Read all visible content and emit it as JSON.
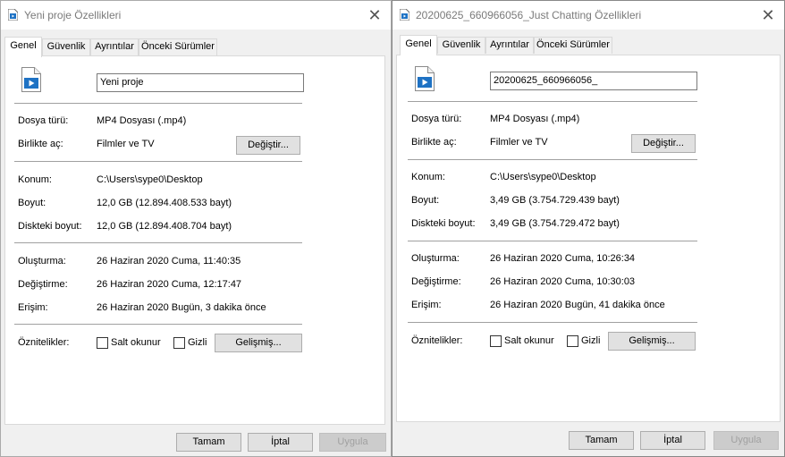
{
  "windows": [
    {
      "title": "Yeni proje Özellikleri",
      "tabs": [
        "Genel",
        "Güvenlik",
        "Ayrıntılar",
        "Önceki Sürümler"
      ],
      "name_value": "Yeni proje",
      "file_type_label": "Dosya türü:",
      "file_type_value": "MP4 Dosyası (.mp4)",
      "open_with_label": "Birlikte aç:",
      "open_with_value": "Filmler ve TV",
      "change_button": "Değiştir...",
      "location_label": "Konum:",
      "location_value": "C:\\Users\\sype0\\Desktop",
      "size_label": "Boyut:",
      "size_value": "12,0 GB (12.894.408.533 bayt)",
      "disk_size_label": "Diskteki boyut:",
      "disk_size_value": "12,0 GB (12.894.408.704 bayt)",
      "created_label": "Oluşturma:",
      "created_value": "26 Haziran 2020 Cuma, 11:40:35",
      "modified_label": "Değiştirme:",
      "modified_value": "26 Haziran 2020 Cuma, 12:17:47",
      "accessed_label": "Erişim:",
      "accessed_value": "26 Haziran 2020 Bugün, 3 dakika önce",
      "attributes_label": "Öznitelikler:",
      "readonly_label": "Salt okunur",
      "hidden_label": "Gizli",
      "advanced_button": "Gelişmiş...",
      "ok_button": "Tamam",
      "cancel_button": "İptal",
      "apply_button": "Uygula"
    },
    {
      "title": "20200625_660966056_Just Chatting Özellikleri",
      "tabs": [
        "Genel",
        "Güvenlik",
        "Ayrıntılar",
        "Önceki Sürümler"
      ],
      "name_value": "20200625_660966056_",
      "file_type_label": "Dosya türü:",
      "file_type_value": "MP4 Dosyası (.mp4)",
      "open_with_label": "Birlikte aç:",
      "open_with_value": "Filmler ve TV",
      "change_button": "Değiştir...",
      "location_label": "Konum:",
      "location_value": "C:\\Users\\sype0\\Desktop",
      "size_label": "Boyut:",
      "size_value": "3,49 GB (3.754.729.439 bayt)",
      "disk_size_label": "Diskteki boyut:",
      "disk_size_value": "3,49 GB (3.754.729.472 bayt)",
      "created_label": "Oluşturma:",
      "created_value": "26 Haziran 2020 Cuma, 10:26:34",
      "modified_label": "Değiştirme:",
      "modified_value": "26 Haziran 2020 Cuma, 10:30:03",
      "accessed_label": "Erişim:",
      "accessed_value": "26 Haziran 2020 Bugün, 41 dakika önce",
      "attributes_label": "Öznitelikler:",
      "readonly_label": "Salt okunur",
      "hidden_label": "Gizli",
      "advanced_button": "Gelişmiş...",
      "ok_button": "Tamam",
      "cancel_button": "İptal",
      "apply_button": "Uygula"
    }
  ],
  "colors": {
    "title_text": "#7a7a7a",
    "accent_blue": "#1e72c4",
    "disabled_text": "#a0a0a0"
  }
}
